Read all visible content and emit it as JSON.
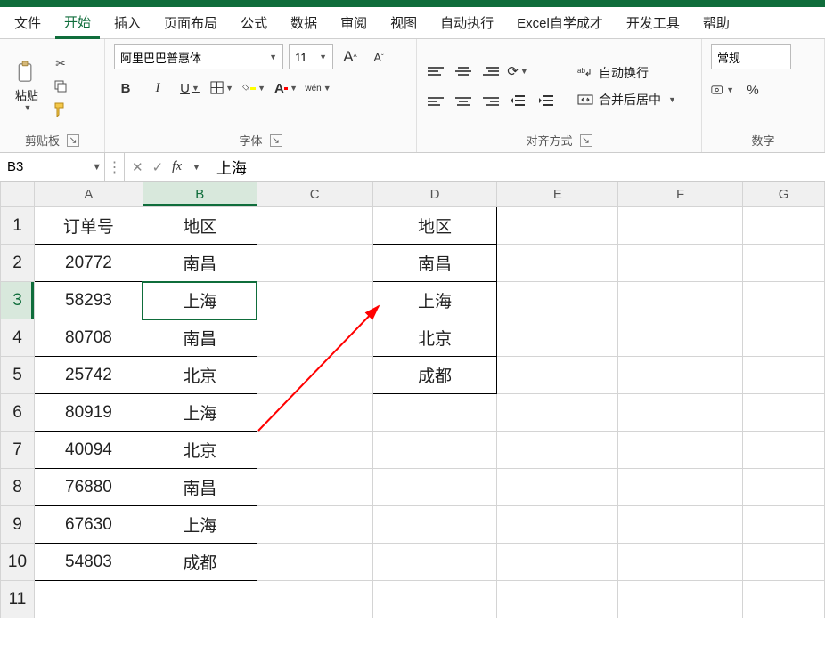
{
  "menu": {
    "file": "文件",
    "home": "开始",
    "insert": "插入",
    "page_layout": "页面布局",
    "formulas": "公式",
    "data": "数据",
    "review": "审阅",
    "view": "视图",
    "automate": "自动执行",
    "excel_self": "Excel自学成才",
    "developer": "开发工具",
    "help": "帮助"
  },
  "ribbon": {
    "clipboard": {
      "paste": "粘贴",
      "label": "剪贴板"
    },
    "font": {
      "name": "阿里巴巴普惠体",
      "size": "11",
      "pinyin": "wén",
      "label": "字体"
    },
    "alignment": {
      "wrap": "自动换行",
      "merge": "合并后居中",
      "label": "对齐方式"
    },
    "number": {
      "format": "常规",
      "label": "数字"
    }
  },
  "formula_bar": {
    "name_box": "B3",
    "value": "上海"
  },
  "columns": [
    "A",
    "B",
    "C",
    "D",
    "E",
    "F",
    "G"
  ],
  "sheet": {
    "A1": "订单号",
    "B1": "地区",
    "D1": "地区",
    "A2": "20772",
    "B2": "南昌",
    "D2": "南昌",
    "A3": "58293",
    "B3": "上海",
    "D3": "上海",
    "A4": "80708",
    "B4": "南昌",
    "D4": "北京",
    "A5": "25742",
    "B5": "北京",
    "D5": "成都",
    "A6": "80919",
    "B6": "上海",
    "A7": "40094",
    "B7": "北京",
    "A8": "76880",
    "B8": "南昌",
    "A9": "67630",
    "B9": "上海",
    "A10": "54803",
    "B10": "成都"
  }
}
